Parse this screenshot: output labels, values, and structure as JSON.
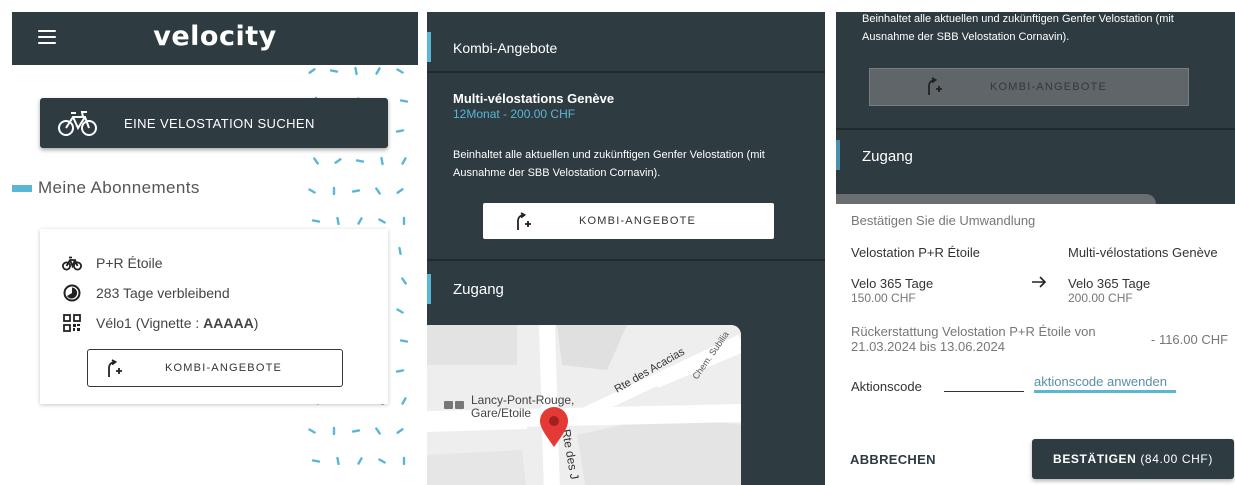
{
  "screen1": {
    "app_title": "velocity",
    "search_button": "EINE VELOSTATION SUCHEN",
    "section_title": "Meine Abonnements",
    "subscription": {
      "station": "P+R Étoile",
      "remaining": "283 Tage verbleibend",
      "vignette_prefix": "Vélo1 (Vignette : ",
      "vignette_code": "AAAAA",
      "vignette_suffix": ")"
    },
    "kombi_button": "KOMBI-ANGEBOTE"
  },
  "screen2": {
    "section_title": "Kombi-Angebote",
    "offer": {
      "title": "Multi-vélostations Genève",
      "price": "12Monat - 200.00 CHF",
      "description": "Beinhaltet alle aktuellen und zukünftigen Genfer Velostation (mit Ausnahme der SBB Velostation Cornavin)."
    },
    "kombi_button": "KOMBI-ANGEBOTE",
    "access_title": "Zugang",
    "map_labels": {
      "stop_line1": "Lancy-Pont-Rouge,",
      "stop_line2": "Gare/Etoile",
      "road1": "Rte des Acacias",
      "road2": "Chem. Subilia",
      "road3": "Rte des J"
    }
  },
  "screen3": {
    "description": "Beinhaltet alle aktuellen und zukünftigen Genfer Velostation (mit Ausnahme der SBB Velostation Cornavin).",
    "kombi_button": "KOMBI-ANGEBOTE",
    "access_title": "Zugang",
    "dialog": {
      "title": "Bestätigen Sie die Umwandlung",
      "from_station": "Velostation P+R Étoile",
      "to_station": "Multi-vélostations Genève",
      "from_plan": "Velo 365 Tage",
      "from_price": "150.00 CHF",
      "to_plan": "Velo 365 Tage",
      "to_price": "200.00 CHF",
      "refund_line1": "Rückerstattung Velostation P+R Étoile von",
      "refund_line2": "21.03.2024 bis 13.06.2024",
      "refund_amount": "- 116.00 CHF",
      "promo_label": "Aktionscode",
      "promo_value": "",
      "promo_link": "aktionscode anwenden",
      "cancel": "ABBRECHEN",
      "confirm": "BESTÄTIGEN",
      "confirm_amount": "(84.00 CHF)"
    }
  },
  "colors": {
    "dark": "#2e3b41",
    "accent": "#5bb6d6",
    "marker": "#e53935"
  }
}
